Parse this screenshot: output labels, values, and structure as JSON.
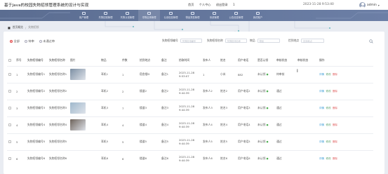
{
  "header": {
    "title": "基于Java的校园失物招领管理系统的设计与实现",
    "links": [
      "首页",
      "个人中心",
      "退出登录",
      "1"
    ],
    "datetime": "2023-11-28 9:53:40",
    "username": "admin"
  },
  "nav": {
    "items": [
      {
        "label": "用户管理"
      },
      {
        "label": "失物招领管理"
      },
      {
        "label": "失物认领管理"
      },
      {
        "label": "寻物启事管理"
      },
      {
        "label": "认领信息管理"
      },
      {
        "label": "物品类型管理"
      },
      {
        "label": "系统管理"
      },
      {
        "label": "公告信息管理"
      },
      {
        "label": "我的账户"
      }
    ],
    "active_index": 3
  },
  "breadcrumb": {
    "home": "首页概览",
    "sep": "/",
    "current": "失物招领"
  },
  "filters": {
    "radios": [
      "全部",
      "待审",
      "未通过审"
    ],
    "fields": [
      {
        "label": "失物招领编号",
        "placeholder": "失物招领编号"
      },
      {
        "label": "失物招领名称",
        "placeholder": "失物招领名称"
      },
      {
        "label": "物品",
        "placeholder": "物品"
      },
      {
        "label": "捡到地点",
        "placeholder": "捡到地点"
      }
    ]
  },
  "table": {
    "columns": [
      "序号",
      "失物招领编号",
      "失物招领名称",
      "图片",
      "物品",
      "件数",
      "拾到地点",
      "备注",
      "拾取时间",
      "发布人",
      "姓名",
      "用户电话",
      "是否认领",
      "审核状态",
      "审核状态",
      "操作"
    ],
    "rows": [
      {
        "index": "1",
        "code": "失物招领编号1",
        "name": "失物招领名称1",
        "thumb": true,
        "thumb_color": "#7c8fa3",
        "item": "耳机1",
        "count": "1",
        "place": "宿舍楼D",
        "note": "备注1",
        "time": "2023-11-28 9:53:07",
        "publisher": "1",
        "realname": "小米",
        "phone": "882",
        "claimed": "未认领",
        "review": "待审核"
      },
      {
        "index": "2",
        "code": "失物招领编号2",
        "name": "失物招领名称2",
        "thumb": false,
        "item": "耳机2",
        "count": "2",
        "place": "楼道2",
        "note": "备注2",
        "time": "2023-11-28 9:44:39",
        "publisher": "发布人2",
        "realname": "姓名2",
        "phone": "用户电话2",
        "claimed": "未认领",
        "review": "通过"
      },
      {
        "index": "3",
        "code": "失物招领编号3",
        "name": "失物招领名称3",
        "thumb": true,
        "thumb_color": "#9fb8cc",
        "item": "耳机3",
        "count": "7",
        "place": "楼道3",
        "note": "备注3",
        "time": "2023-11-28 9:44:39",
        "publisher": "发布人3",
        "realname": "姓名3",
        "phone": "用户电话3",
        "claimed": "未认领",
        "review": "通过"
      },
      {
        "index": "4",
        "code": "失物招领编号4",
        "name": "失物招领名称4",
        "thumb": true,
        "thumb_color": "#6d625a",
        "item": "耳机4",
        "count": "4",
        "place": "楼道4",
        "note": "备注4",
        "time": "2023-11-28 9:44:39",
        "publisher": "发布人4",
        "realname": "姓名4",
        "phone": "用户电话4",
        "claimed": "未认领",
        "review": "通过"
      },
      {
        "index": "5",
        "code": "失物招领编号5",
        "name": "失物招领名称5",
        "thumb": false,
        "item": "耳机5",
        "count": "5",
        "place": "楼道5",
        "note": "备注5",
        "time": "2023-11-28 9:44:39",
        "publisher": "发布人5",
        "realname": "姓名5",
        "phone": "用户电话5",
        "claimed": "未认领",
        "review": "通过"
      },
      {
        "index": "6",
        "code": "失物招领编号6",
        "name": "失物招领名称6",
        "thumb": false,
        "item": "耳机6",
        "count": "6",
        "place": "楼道6",
        "note": "备注6",
        "time": "2023-11-28 9:44:39",
        "publisher": "发布人6",
        "realname": "姓名6",
        "phone": "用户电话6",
        "claimed": "未认领",
        "review": "通过"
      }
    ],
    "claimed_badge": "●",
    "actions": {
      "view": "详情",
      "edit": "修改",
      "del": "删除"
    }
  },
  "colors": {
    "nav": "#5b6d91",
    "accent_red": "#e24d4d",
    "view": "#3a9bd5",
    "edit": "#5aa36b",
    "del": "#e05d5d"
  }
}
